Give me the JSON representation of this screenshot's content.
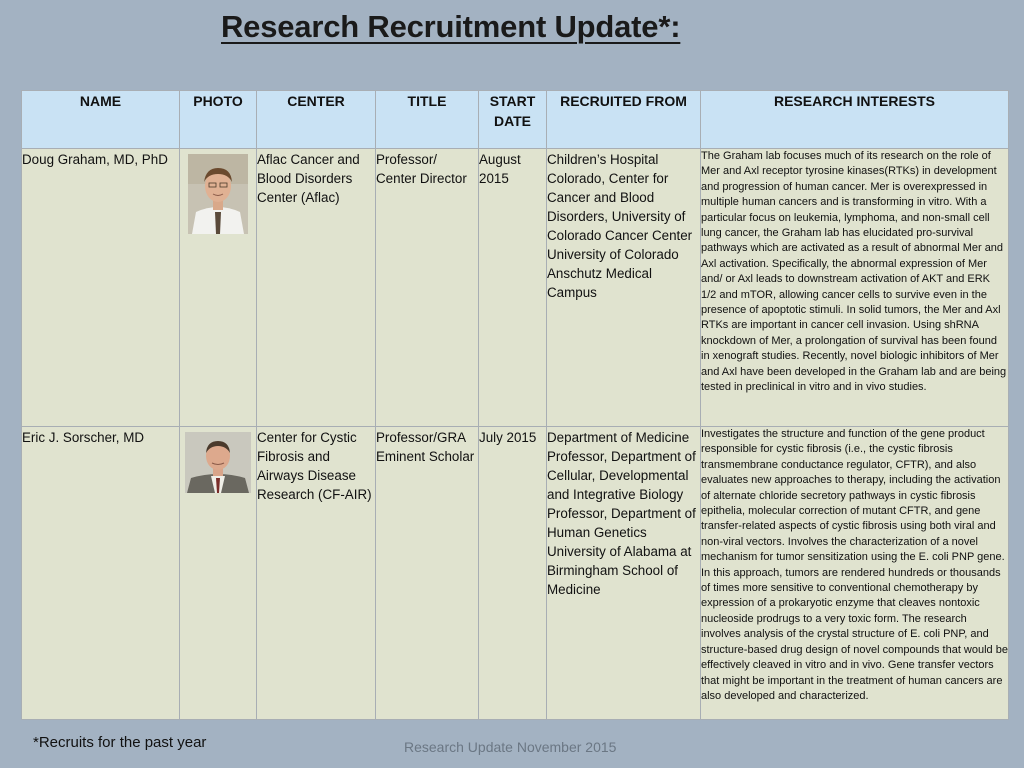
{
  "title": "Research Recruitment Update*:",
  "table": {
    "headers": [
      "NAME",
      "PHOTO",
      "CENTER",
      "TITLE",
      "START DATE",
      "RECRUITED FROM",
      "RESEARCH INTERESTS"
    ],
    "rows": [
      {
        "name": "Doug Graham, MD, PhD",
        "center": "Aflac Cancer and Blood Disorders Center (Aflac)",
        "title": "Professor/ Center Director",
        "start_date": "August 2015",
        "recruited_from": "Children’s Hospital Colorado, Center for Cancer and Blood Disorders, University of Colorado Cancer Center University of Colorado Anschutz Medical Campus",
        "research_interests": "The Graham lab focuses much of its research on the role of Mer and Axl receptor tyrosine kinases(RTKs) in development and progression of human cancer. Mer is overexpressed in multiple human cancers and is transforming in vitro. With a particular focus on leukemia, lymphoma, and non-small cell lung cancer, the Graham lab has elucidated pro-survival pathways which are activated as a result of abnormal Mer and Axl activation. Specifically, the abnormal expression of Mer and/ or Axl leads to downstream activation of AKT and ERK 1/2 and mTOR, allowing cancer cells to survive even in the presence of apoptotic stimuli. In solid tumors, the Mer and Axl RTKs are important in cancer cell invasion. Using shRNA knockdown of Mer, a prolongation of survival has been found in xenograft studies. Recently, novel biologic inhibitors of Mer and Axl have been developed in the Graham lab and are being tested in preclinical in vitro and in vivo studies."
      },
      {
        "name": "Eric J. Sorscher, MD",
        "center": "Center for Cystic Fibrosis and Airways Disease Research (CF-AIR)",
        "title": "Professor/GRA Eminent Scholar",
        "start_date": "July 2015",
        "recruited_from": "Department of Medicine Professor, Department of Cellular, Developmental and Integrative Biology Professor, Department of Human Genetics University of Alabama at Birmingham School of Medicine",
        "research_interests": "Investigates the structure and function of the gene product responsible for cystic fibrosis (i.e., the cystic fibrosis transmembrane conductance regulator, CFTR), and also evaluates new approaches to therapy, including the activation of alternate chloride secretory pathways in cystic fibrosis epithelia, molecular correction of mutant CFTR, and gene transfer-related aspects of cystic fibrosis using both viral and non-viral vectors.  Involves the characterization of a novel mechanism for tumor sensitization using the E. coli PNP gene. In this approach, tumors are rendered hundreds or thousands of times more sensitive to conventional chemotherapy by expression of a prokaryotic enzyme that cleaves nontoxic nucleoside prodrugs to a very toxic form. The research involves analysis of the crystal structure of E. coli PNP, and structure-based drug design of novel compounds that would be effectively cleaved in vitro and in vivo. Gene transfer vectors that might be important in the treatment of human cancers are also developed and characterized."
      }
    ]
  },
  "footnote": "*Recruits for the past year",
  "footer": "Research Update November 2015",
  "colors": {
    "background": "#a3b2c2",
    "header_fill": "#c9e2f4",
    "row_fill": "#e0e3cf"
  }
}
